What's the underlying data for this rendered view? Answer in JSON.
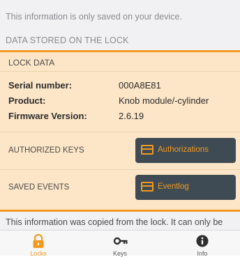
{
  "top": {
    "note": "This information is only saved on your device.",
    "section_header": "DATA STORED ON THE LOCK"
  },
  "lock_data": {
    "title": "LOCK DATA",
    "rows": [
      {
        "key": "Serial number:",
        "value": "000A8E81"
      },
      {
        "key": "Product:",
        "value": "Knob module/-cylinder"
      },
      {
        "key": "Firmware Version:",
        "value": "2.6.19"
      }
    ]
  },
  "authorized_keys": {
    "label": "AUTHORIZED KEYS",
    "button": "Authorizations"
  },
  "saved_events": {
    "label": "SAVED EVENTS",
    "button": "Eventlog"
  },
  "bottom_note": "This information was copied from the lock. It can only be edited when connected to the lock.",
  "tabs": [
    {
      "label": "Locks",
      "icon": "lock-icon",
      "active": true
    },
    {
      "label": "Keys",
      "icon": "key-icon",
      "active": false
    },
    {
      "label": "Info",
      "icon": "info-icon",
      "active": false
    }
  ],
  "colors": {
    "accent": "#f29a1f",
    "card_bg": "#fde6c8",
    "button_bg": "#3e4a54"
  }
}
